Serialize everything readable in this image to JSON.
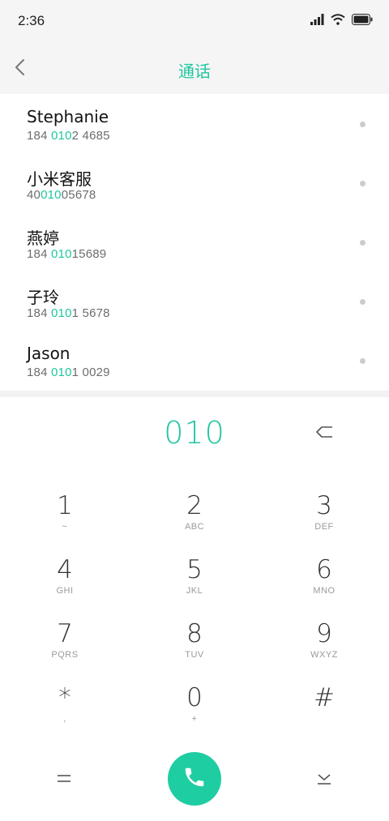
{
  "status_bar": {
    "time": "2:36",
    "icons": [
      "signal-icon",
      "wifi-icon",
      "battery-icon"
    ]
  },
  "header": {
    "title": "通话",
    "back_icon": "chevron-left-icon"
  },
  "contacts": [
    {
      "name": "Stephanie",
      "num_before": "184 ",
      "num_match": "010",
      "num_after": "2 4685"
    },
    {
      "name": "小米客服",
      "num_before": "40",
      "num_match": "010",
      "num_after": "05678"
    },
    {
      "name": "燕婷",
      "num_before": "184 ",
      "num_match": "010",
      "num_after": "15689"
    },
    {
      "name": "子玲",
      "num_before": "184 ",
      "num_match": "010",
      "num_after": "1 5678"
    },
    {
      "name": "Jason",
      "num_before": "184 ",
      "num_match": "010",
      "num_after": "1 0029"
    }
  ],
  "dialer": {
    "entered_number": "010",
    "keys": [
      {
        "digit": "1",
        "letters": "~"
      },
      {
        "digit": "2",
        "letters": "ABC"
      },
      {
        "digit": "3",
        "letters": "DEF"
      },
      {
        "digit": "4",
        "letters": "GHI"
      },
      {
        "digit": "5",
        "letters": "JKL"
      },
      {
        "digit": "6",
        "letters": "MNO"
      },
      {
        "digit": "7",
        "letters": "PQRS"
      },
      {
        "digit": "8",
        "letters": "TUV"
      },
      {
        "digit": "9",
        "letters": "WXYZ"
      },
      {
        "digit": "*",
        "letters": ","
      },
      {
        "digit": "0",
        "letters": "+"
      },
      {
        "digit": "#",
        "letters": ""
      }
    ]
  },
  "colors": {
    "accent": "#1fc7a0",
    "call_button": "#1fcda2",
    "header_bg": "#f5f5f5"
  }
}
